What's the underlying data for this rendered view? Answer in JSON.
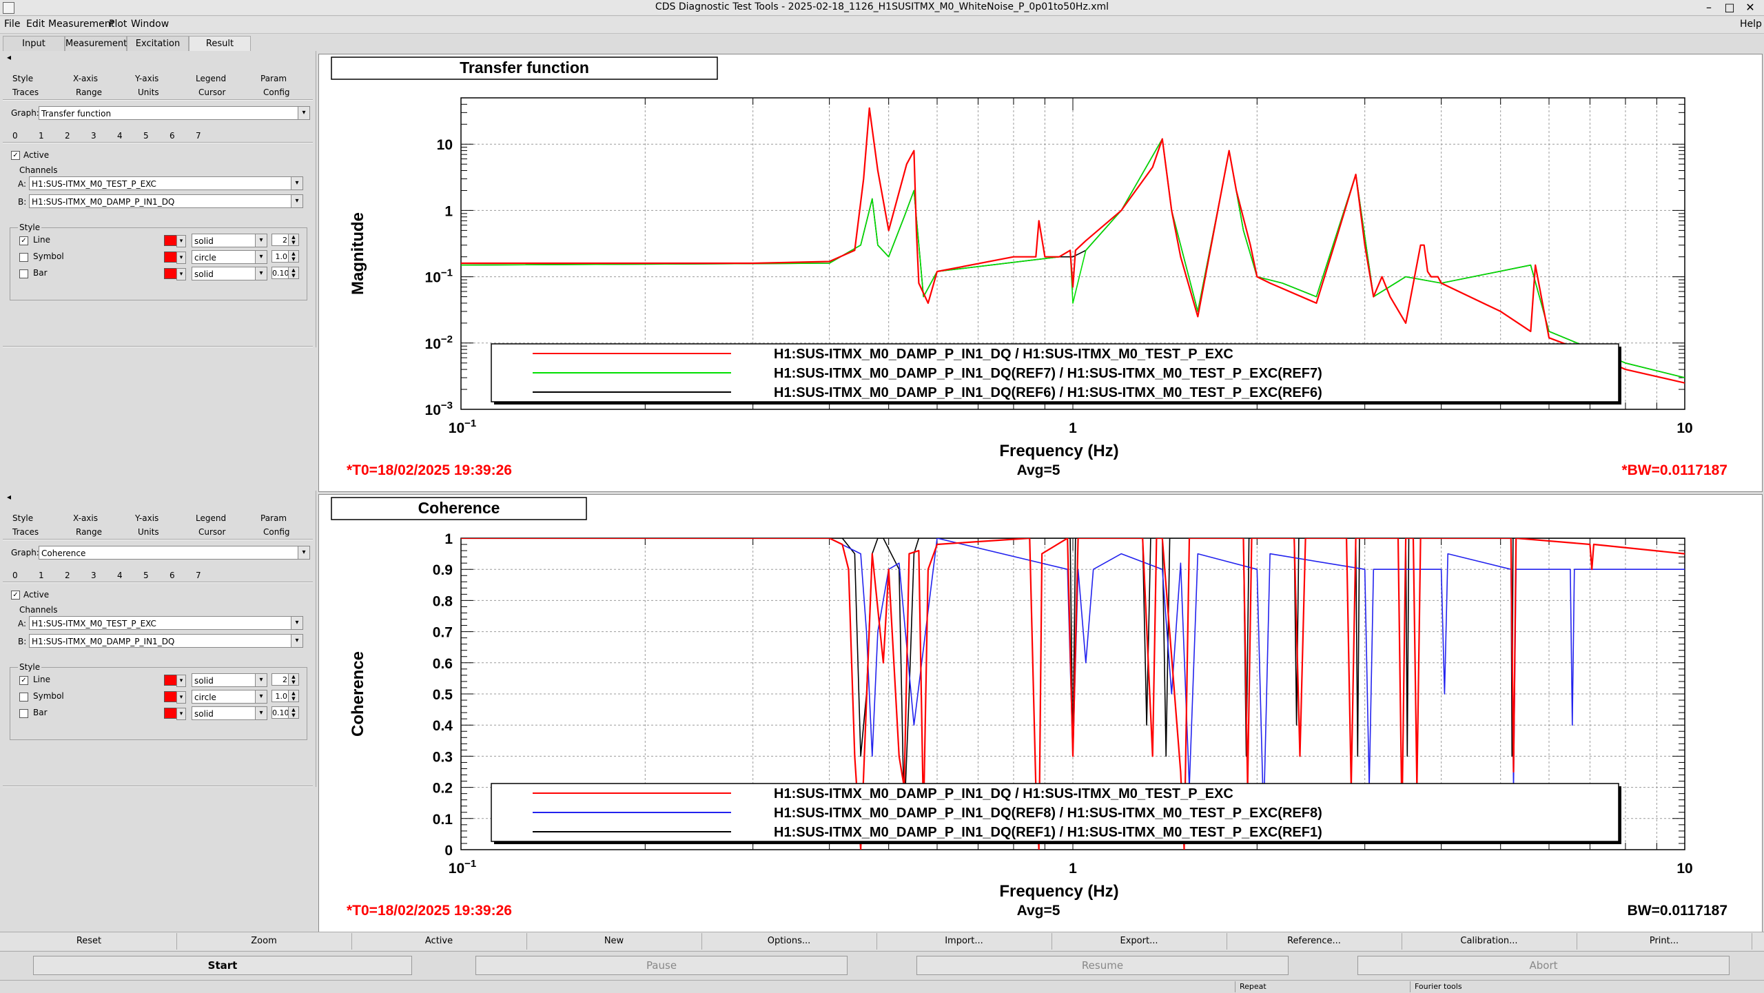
{
  "window": {
    "title": "CDS Diagnostic Test Tools - 2025-02-18_1126_H1SUSITMX_M0_WhiteNoise_P_0p01to50Hz.xml",
    "minimize": "–",
    "maximize": "□",
    "close": "✕"
  },
  "menu": [
    "File",
    "Edit",
    "Measurement",
    "Plot",
    "Window",
    "Help"
  ],
  "tabs": [
    "Input",
    "Measurement",
    "Excitation",
    "Result"
  ],
  "panels": [
    {
      "collapse": "◂",
      "subtabs_row1": [
        "Style",
        "X-axis",
        "Y-axis",
        "Legend",
        "Param"
      ],
      "subtabs_row2": [
        "Traces",
        "Range",
        "Units",
        "Cursor",
        "Config"
      ],
      "graph_label": "Graph:",
      "graph_value": "Transfer function",
      "numbers": [
        "0",
        "1",
        "2",
        "3",
        "4",
        "5",
        "6",
        "7"
      ],
      "active_label": "Active",
      "channels_label": "Channels",
      "channel_a_label": "A:",
      "channel_a": "H1:SUS-ITMX_M0_TEST_P_EXC",
      "channel_b_label": "B:",
      "channel_b": "H1:SUS-ITMX_M0_DAMP_P_IN1_DQ",
      "style_label": "Style",
      "line_label": "Line",
      "line_style": "solid",
      "line_width": "2",
      "symbol_label": "Symbol",
      "symbol_style": "circle",
      "symbol_size": "1.0",
      "bar_label": "Bar",
      "bar_style": "solid",
      "bar_width": "0.10"
    },
    {
      "collapse": "◂",
      "subtabs_row1": [
        "Style",
        "X-axis",
        "Y-axis",
        "Legend",
        "Param"
      ],
      "subtabs_row2": [
        "Traces",
        "Range",
        "Units",
        "Cursor",
        "Config"
      ],
      "graph_label": "Graph:",
      "graph_value": "Coherence",
      "numbers": [
        "0",
        "1",
        "2",
        "3",
        "4",
        "5",
        "6",
        "7"
      ],
      "active_label": "Active",
      "channels_label": "Channels",
      "channel_a_label": "A:",
      "channel_a": "H1:SUS-ITMX_M0_TEST_P_EXC",
      "channel_b_label": "B:",
      "channel_b": "H1:SUS-ITMX_M0_DAMP_P_IN1_DQ",
      "style_label": "Style",
      "line_label": "Line",
      "line_style": "solid",
      "line_width": "2",
      "symbol_label": "Symbol",
      "symbol_style": "circle",
      "symbol_size": "1.0",
      "bar_label": "Bar",
      "bar_style": "solid",
      "bar_width": "0.10"
    }
  ],
  "plots": [
    {
      "title": "Transfer function",
      "ylabel": "Magnitude",
      "xlabel": "Frequency (Hz)",
      "yticks": [
        {
          "v": 10,
          "base": "10",
          "exp": ""
        },
        {
          "v": 1,
          "base": "1",
          "exp": ""
        },
        {
          "v": 0.1,
          "base": "10",
          "exp": "−1"
        },
        {
          "v": 0.01,
          "base": "10",
          "exp": "−2"
        },
        {
          "v": 0.001,
          "base": "10",
          "exp": "−3"
        }
      ],
      "xticks": [
        {
          "v": 0.1,
          "base": "10",
          "exp": "−1"
        },
        {
          "v": 1,
          "base": "1",
          "exp": ""
        },
        {
          "v": 10,
          "base": "10",
          "exp": ""
        }
      ],
      "legend": [
        {
          "label": "H1:SUS-ITMX_M0_DAMP_P_IN1_DQ / H1:SUS-ITMX_M0_TEST_P_EXC",
          "color": "#ff0000"
        },
        {
          "label": "H1:SUS-ITMX_M0_DAMP_P_IN1_DQ(REF7) / H1:SUS-ITMX_M0_TEST_P_EXC(REF7)",
          "color": "#00e000"
        },
        {
          "label": "H1:SUS-ITMX_M0_DAMP_P_IN1_DQ(REF6) / H1:SUS-ITMX_M0_TEST_P_EXC(REF6)",
          "color": "#000000"
        }
      ],
      "t0": "*T0=18/02/2025 19:39:26",
      "avg": "Avg=5",
      "bw": "*BW=0.0117187",
      "bw_color": "#ff0000"
    },
    {
      "title": "Coherence",
      "ylabel": "Coherence",
      "xlabel": "Frequency (Hz)",
      "yticks": [
        {
          "v": 1,
          "base": "1",
          "exp": ""
        },
        {
          "v": 0.9,
          "base": "0.9",
          "exp": ""
        },
        {
          "v": 0.8,
          "base": "0.8",
          "exp": ""
        },
        {
          "v": 0.7,
          "base": "0.7",
          "exp": ""
        },
        {
          "v": 0.6,
          "base": "0.6",
          "exp": ""
        },
        {
          "v": 0.5,
          "base": "0.5",
          "exp": ""
        },
        {
          "v": 0.4,
          "base": "0.4",
          "exp": ""
        },
        {
          "v": 0.3,
          "base": "0.3",
          "exp": ""
        },
        {
          "v": 0.2,
          "base": "0.2",
          "exp": ""
        },
        {
          "v": 0.1,
          "base": "0.1",
          "exp": ""
        },
        {
          "v": 0,
          "base": "0",
          "exp": ""
        }
      ],
      "xticks": [
        {
          "v": 0.1,
          "base": "10",
          "exp": "−1"
        },
        {
          "v": 1,
          "base": "1",
          "exp": ""
        },
        {
          "v": 10,
          "base": "10",
          "exp": ""
        }
      ],
      "legend": [
        {
          "label": "H1:SUS-ITMX_M0_DAMP_P_IN1_DQ / H1:SUS-ITMX_M0_TEST_P_EXC",
          "color": "#ff0000"
        },
        {
          "label": "H1:SUS-ITMX_M0_DAMP_P_IN1_DQ(REF8) / H1:SUS-ITMX_M0_TEST_P_EXC(REF8)",
          "color": "#2222ee"
        },
        {
          "label": "H1:SUS-ITMX_M0_DAMP_P_IN1_DQ(REF1) / H1:SUS-ITMX_M0_TEST_P_EXC(REF1)",
          "color": "#000000"
        }
      ],
      "t0": "*T0=18/02/2025 19:39:26",
      "avg": "Avg=5",
      "bw": "BW=0.0117187",
      "bw_color": "#000000"
    }
  ],
  "chart_data": [
    {
      "type": "line",
      "title": "Transfer function",
      "xlabel": "Frequency (Hz)",
      "ylabel": "Magnitude",
      "xscale": "log",
      "yscale": "log",
      "xlim": [
        0.1,
        10
      ],
      "ylim": [
        0.001,
        50
      ],
      "grid": true,
      "legend_position": "bottom",
      "series": [
        {
          "name": "H1:SUS-ITMX_M0_DAMP_P_IN1_DQ / H1:SUS-ITMX_M0_TEST_P_EXC",
          "color": "#ff0000",
          "x": [
            0.1,
            0.3,
            0.4,
            0.44,
            0.455,
            0.465,
            0.48,
            0.5,
            0.535,
            0.55,
            0.555,
            0.56,
            0.58,
            0.6,
            0.8,
            0.87,
            0.88,
            0.9,
            0.95,
            0.99,
            1.0,
            1.01,
            1.05,
            1.2,
            1.35,
            1.4,
            1.45,
            1.5,
            1.6,
            1.75,
            1.8,
            1.85,
            1.95,
            2.0,
            2.1,
            2.5,
            2.7,
            2.9,
            3.0,
            3.1,
            3.2,
            3.3,
            3.5,
            3.7,
            3.75,
            3.8,
            3.85,
            3.95,
            4.0,
            5.0,
            5.6,
            5.7,
            6.0,
            7.0,
            8.0,
            10.0
          ],
          "y": [
            0.16,
            0.16,
            0.17,
            0.25,
            3.0,
            35.0,
            4.0,
            0.5,
            5.0,
            8.0,
            0.5,
            0.08,
            0.04,
            0.12,
            0.2,
            0.2,
            0.7,
            0.2,
            0.2,
            0.25,
            0.07,
            0.25,
            0.35,
            1.0,
            4.5,
            12.0,
            1.0,
            0.2,
            0.025,
            2.0,
            8.0,
            2.0,
            0.3,
            0.1,
            0.08,
            0.04,
            0.4,
            3.5,
            0.3,
            0.05,
            0.1,
            0.05,
            0.02,
            0.3,
            0.3,
            0.12,
            0.1,
            0.1,
            0.08,
            0.03,
            0.015,
            0.15,
            0.012,
            0.007,
            0.004,
            0.0025
          ]
        },
        {
          "name": "H1:SUS-ITMX_M0_DAMP_P_IN1_DQ(REF7) / H1:SUS-ITMX_M0_TEST_P_EXC(REF7)",
          "color": "#00e000",
          "x": [
            0.1,
            0.4,
            0.45,
            0.47,
            0.48,
            0.5,
            0.53,
            0.55,
            0.57,
            0.6,
            0.95,
            0.99,
            1.0,
            1.05,
            1.2,
            1.4,
            1.45,
            1.6,
            1.75,
            1.8,
            1.9,
            2.0,
            2.2,
            2.5,
            2.9,
            3.1,
            3.5,
            4.0,
            5.6,
            6.0,
            8.0,
            10.0
          ],
          "y": [
            0.15,
            0.16,
            0.3,
            1.5,
            0.3,
            0.2,
            0.8,
            2.0,
            0.05,
            0.12,
            0.2,
            0.25,
            0.04,
            0.25,
            1.0,
            12.0,
            1.0,
            0.03,
            2.0,
            8.0,
            0.5,
            0.1,
            0.08,
            0.05,
            3.5,
            0.05,
            0.1,
            0.08,
            0.15,
            0.015,
            0.005,
            0.003
          ]
        },
        {
          "name": "H1:SUS-ITMX_M0_DAMP_P_IN1_DQ(REF6) / H1:SUS-ITMX_M0_TEST_P_EXC(REF6)",
          "color": "#000000",
          "x": [
            0.1,
            0.4,
            0.45,
            0.47,
            0.48,
            0.5,
            0.53,
            0.55,
            0.57,
            0.6,
            0.95,
            1.0,
            1.05,
            1.2,
            1.4,
            1.45,
            1.6,
            1.75,
            1.8,
            1.9,
            2.0,
            2.2,
            2.5,
            2.9,
            3.1,
            3.5,
            4.0,
            5.6,
            6.0,
            8.0,
            10.0
          ],
          "y": [
            0.15,
            0.16,
            0.3,
            1.5,
            0.3,
            0.2,
            0.8,
            2.0,
            0.05,
            0.12,
            0.2,
            0.2,
            0.25,
            1.0,
            12.0,
            1.0,
            0.03,
            2.0,
            8.0,
            0.5,
            0.1,
            0.08,
            0.05,
            3.5,
            0.05,
            0.1,
            0.08,
            0.15,
            0.015,
            0.005,
            0.003
          ]
        }
      ]
    },
    {
      "type": "line",
      "title": "Coherence",
      "xlabel": "Frequency (Hz)",
      "ylabel": "Coherence",
      "xscale": "log",
      "yscale": "linear",
      "xlim": [
        0.1,
        10
      ],
      "ylim": [
        0,
        1
      ],
      "grid": true,
      "legend_position": "bottom",
      "series": [
        {
          "name": "H1:SUS-ITMX_M0_DAMP_P_IN1_DQ / H1:SUS-ITMX_M0_TEST_P_EXC",
          "color": "#ff0000",
          "x": [
            0.1,
            0.4,
            0.42,
            0.43,
            0.44,
            0.45,
            0.47,
            0.49,
            0.5,
            0.52,
            0.53,
            0.54,
            0.56,
            0.57,
            0.58,
            0.6,
            0.85,
            0.87,
            0.88,
            0.89,
            0.98,
            1.0,
            1.02,
            1.3,
            1.35,
            1.37,
            1.4,
            1.5,
            1.52,
            1.55,
            1.9,
            1.93,
            1.96,
            2.3,
            2.35,
            2.4,
            2.8,
            2.85,
            2.9,
            3.4,
            3.45,
            3.5,
            3.6,
            3.65,
            3.7,
            5.2,
            5.25,
            5.3,
            7.0,
            7.05,
            7.1,
            10.0
          ],
          "y": [
            1.0,
            1.0,
            0.98,
            0.9,
            0.3,
            0.0,
            0.95,
            0.6,
            0.9,
            0.3,
            0.2,
            0.95,
            0.96,
            0.1,
            0.9,
            0.98,
            1.0,
            0.2,
            0.0,
            0.95,
            1.0,
            0.3,
            1.0,
            1.0,
            0.3,
            1.0,
            1.0,
            0.25,
            0.0,
            1.0,
            1.0,
            0.2,
            1.0,
            1.0,
            0.3,
            1.0,
            1.0,
            0.2,
            1.0,
            1.0,
            0.1,
            1.0,
            1.0,
            0.2,
            1.0,
            1.0,
            0.25,
            1.0,
            0.98,
            0.9,
            0.98,
            0.95
          ]
        },
        {
          "name": "H1:SUS-ITMX_M0_DAMP_P_IN1_DQ(REF8) / H1:SUS-ITMX_M0_TEST_P_EXC(REF8)",
          "color": "#2222ee",
          "x": [
            0.1,
            0.4,
            0.45,
            0.46,
            0.47,
            0.48,
            0.5,
            0.52,
            0.55,
            0.6,
            0.98,
            1.0,
            1.02,
            1.05,
            1.08,
            1.2,
            1.4,
            1.45,
            1.5,
            1.55,
            1.6,
            2.0,
            2.05,
            2.1,
            3.0,
            3.05,
            3.1,
            4.0,
            4.05,
            4.1,
            5.2,
            5.25,
            5.3,
            6.5,
            6.55,
            6.6,
            10.0
          ],
          "y": [
            1.0,
            1.0,
            0.95,
            0.7,
            0.3,
            0.7,
            0.9,
            0.92,
            0.4,
            1.0,
            0.9,
            0.3,
            0.9,
            0.6,
            0.9,
            0.95,
            0.9,
            0.5,
            0.92,
            0.2,
            0.95,
            0.9,
            0.1,
            0.95,
            0.9,
            0.2,
            0.9,
            0.9,
            0.5,
            0.95,
            0.9,
            0.2,
            0.9,
            0.9,
            0.4,
            0.9,
            0.9
          ]
        },
        {
          "name": "H1:SUS-ITMX_M0_DAMP_P_IN1_DQ(REF1) / H1:SUS-ITMX_M0_TEST_P_EXC(REF1)",
          "color": "#000000",
          "x": [
            0.1,
            0.42,
            0.44,
            0.45,
            0.46,
            0.47,
            0.48,
            0.49,
            0.52,
            0.53,
            0.54,
            0.55,
            0.56,
            0.6,
            0.99,
            1.0,
            1.01,
            1.3,
            1.32,
            1.34,
            1.4,
            1.42,
            1.44,
            1.9,
            1.92,
            1.94,
            2.3,
            2.32,
            2.34,
            2.9,
            2.92,
            2.94,
            3.5,
            3.52,
            3.54,
            5.2,
            5.22,
            5.24,
            10.0
          ],
          "y": [
            1.0,
            1.0,
            0.95,
            0.3,
            0.5,
            0.95,
            1.0,
            1.0,
            0.9,
            0.1,
            0.5,
            0.95,
            1.0,
            1.0,
            1.0,
            0.3,
            1.0,
            1.0,
            0.4,
            1.0,
            1.0,
            0.3,
            1.0,
            1.0,
            0.3,
            1.0,
            1.0,
            0.4,
            1.0,
            1.0,
            0.3,
            1.0,
            1.0,
            0.3,
            1.0,
            1.0,
            0.3,
            1.0,
            1.0
          ]
        }
      ]
    }
  ],
  "bottom_buttons": [
    "Reset",
    "Zoom",
    "Active",
    "New",
    "Options...",
    "Import...",
    "Export...",
    "Reference...",
    "Calibration...",
    "Print..."
  ],
  "control_buttons": [
    "Start",
    "Pause",
    "Resume",
    "Abort"
  ],
  "status": [
    "Repeat",
    "Fourier tools"
  ]
}
